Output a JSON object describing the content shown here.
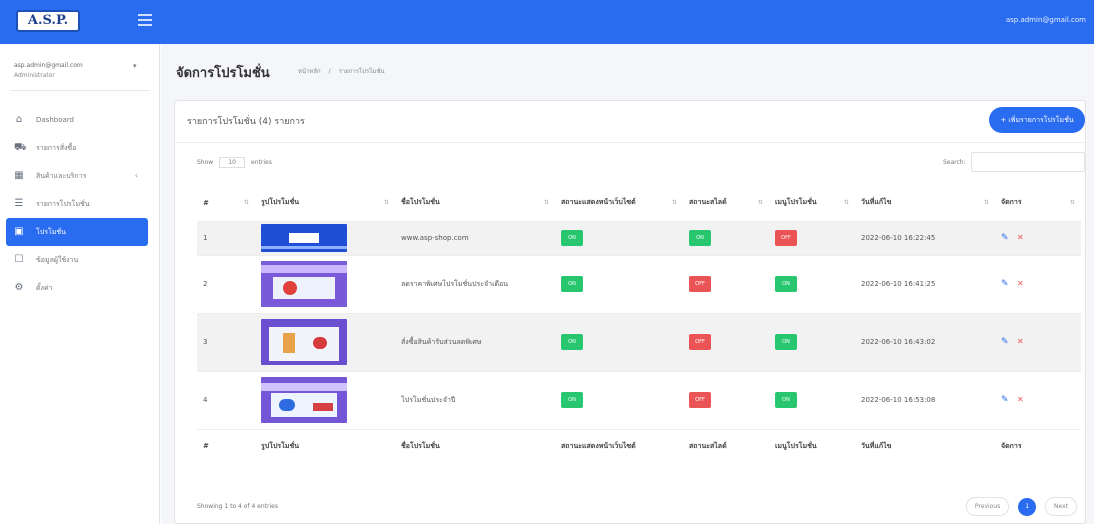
{
  "app": {
    "logo_text": "A.S.P.",
    "topbar_user": "asp.admin@gmail.com"
  },
  "colors": {
    "primary": "#2a6cf0",
    "success": "#28c76f",
    "danger": "#ea5455",
    "sidebar_bg": "#ffffff",
    "content_bg": "#f4f6f9"
  },
  "sidebar": {
    "user_email": "asp.admin@gmail.com",
    "user_role": "Administrator",
    "items": [
      {
        "label": "Dashboard",
        "icon": "home-icon",
        "active": false,
        "has_sub": false
      },
      {
        "label": "รายการสั่งซื้อ",
        "icon": "cart-icon",
        "active": false,
        "has_sub": false
      },
      {
        "label": "สินค้าและบริการ",
        "icon": "box-icon",
        "active": false,
        "has_sub": true
      },
      {
        "label": "รายการโปรโมชั่น",
        "icon": "list-icon",
        "active": false,
        "has_sub": false
      },
      {
        "label": "โปรโมชั่น",
        "icon": "megaphone-icon",
        "active": true,
        "has_sub": false
      },
      {
        "label": "ข้อมูลผู้ใช้งาน",
        "icon": "user-icon",
        "active": false,
        "has_sub": false
      },
      {
        "label": "ตั้งค่า",
        "icon": "gear-icon",
        "active": false,
        "has_sub": false
      }
    ]
  },
  "page": {
    "title": "จัดการโปรโมชั่น",
    "breadcrumb": [
      "หน้าหลัก",
      "/",
      "รายการโปรโมชั่น"
    ]
  },
  "card": {
    "title": "รายการโปรโมชั่น (4) รายการ",
    "add_button": "+ เพิ่มรายการโปรโมชั่น",
    "show_label": "Show",
    "show_value": "10",
    "entries_label": "entries",
    "search_label": "Search:"
  },
  "table": {
    "columns": [
      "#",
      "รูปโปรโมชั่น",
      "ชื่อโปรโมชั่น",
      "สถานะแสดงหน้าเว็บไซต์",
      "สถานะสไลด์",
      "เมนูโปรโมชั่น",
      "วันที่แก้ไข",
      "จัดการ"
    ],
    "rows": [
      {
        "index": "1",
        "name": "www.asp-shop.com",
        "status_web": "on",
        "status_web_label": "ON",
        "status_slide": "on",
        "status_slide_label": "ON",
        "status_menu": "off",
        "status_menu_label": "OFF",
        "date": "2022-06-10 16:22:45",
        "thumb": "banner-blue"
      },
      {
        "index": "2",
        "name": "ลดราคาพิเศษโปรโมชั่นประจำเดือน",
        "status_web": "on",
        "status_web_label": "ON",
        "status_slide": "off",
        "status_slide_label": "OFF",
        "status_menu": "on",
        "status_menu_label": "ON",
        "date": "2022-06-10 16:41:25",
        "thumb": "banner-purple"
      },
      {
        "index": "3",
        "name": "สั่งซื้อสินค้ารับส่วนลดพิเศษ",
        "status_web": "on",
        "status_web_label": "ON",
        "status_slide": "off",
        "status_slide_label": "OFF",
        "status_menu": "on",
        "status_menu_label": "ON",
        "date": "2022-06-10 16:43:02",
        "thumb": "banner-promo"
      },
      {
        "index": "4",
        "name": "โปรโมชั่นประจำปี",
        "status_web": "on",
        "status_web_label": "ON",
        "status_slide": "off",
        "status_slide_label": "OFF",
        "status_menu": "on",
        "status_menu_label": "ON",
        "date": "2022-06-10 16:53:08",
        "thumb": "banner-sale"
      }
    ]
  },
  "footer": {
    "info": "Showing 1 to 4 of 4 entries",
    "previous": "Previous",
    "page": "1",
    "next": "Next"
  }
}
